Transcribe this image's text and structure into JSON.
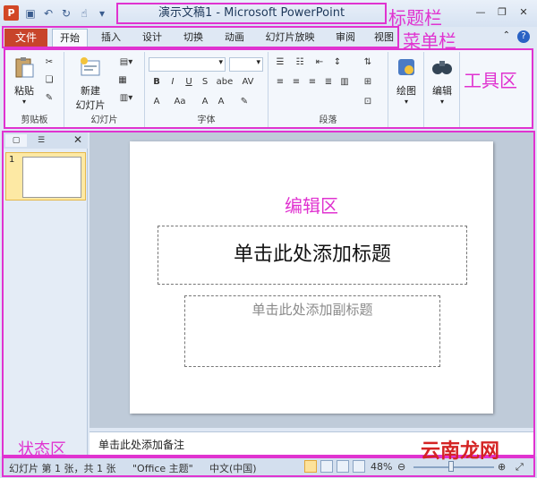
{
  "titlebar": {
    "app_icon": "P",
    "title": "演示文稿1 - Microsoft PowerPoint",
    "annotation": "标题栏"
  },
  "menubar": {
    "file": "文件",
    "tabs": [
      "开始",
      "插入",
      "设计",
      "切换",
      "动画",
      "幻灯片放映",
      "审阅",
      "视图"
    ],
    "annotation": "菜单栏"
  },
  "ribbon": {
    "annotation": "工具区",
    "paste": "粘贴",
    "new_slide_1": "新建",
    "new_slide_2": "幻灯片",
    "draw": "绘图",
    "edit": "编辑",
    "groups": {
      "clipboard": "剪贴板",
      "slides": "幻灯片",
      "font": "字体",
      "paragraph": "段落"
    }
  },
  "thumbs": {
    "slide_number": "1"
  },
  "editor": {
    "annotation": "编辑区",
    "title_placeholder": "单击此处添加标题",
    "subtitle_placeholder": "单击此处添加副标题"
  },
  "notes": {
    "placeholder": "单击此处添加备注"
  },
  "status": {
    "annotation": "状态区",
    "slide_info": "幻灯片 第 1 张，共 1 张",
    "theme": "\"Office 主题\"",
    "language": "中文(中国)",
    "zoom": "48%"
  },
  "watermark": "云南龙网",
  "colors": {
    "annotation": "#e033d0",
    "file_tab": "#c8442b"
  }
}
